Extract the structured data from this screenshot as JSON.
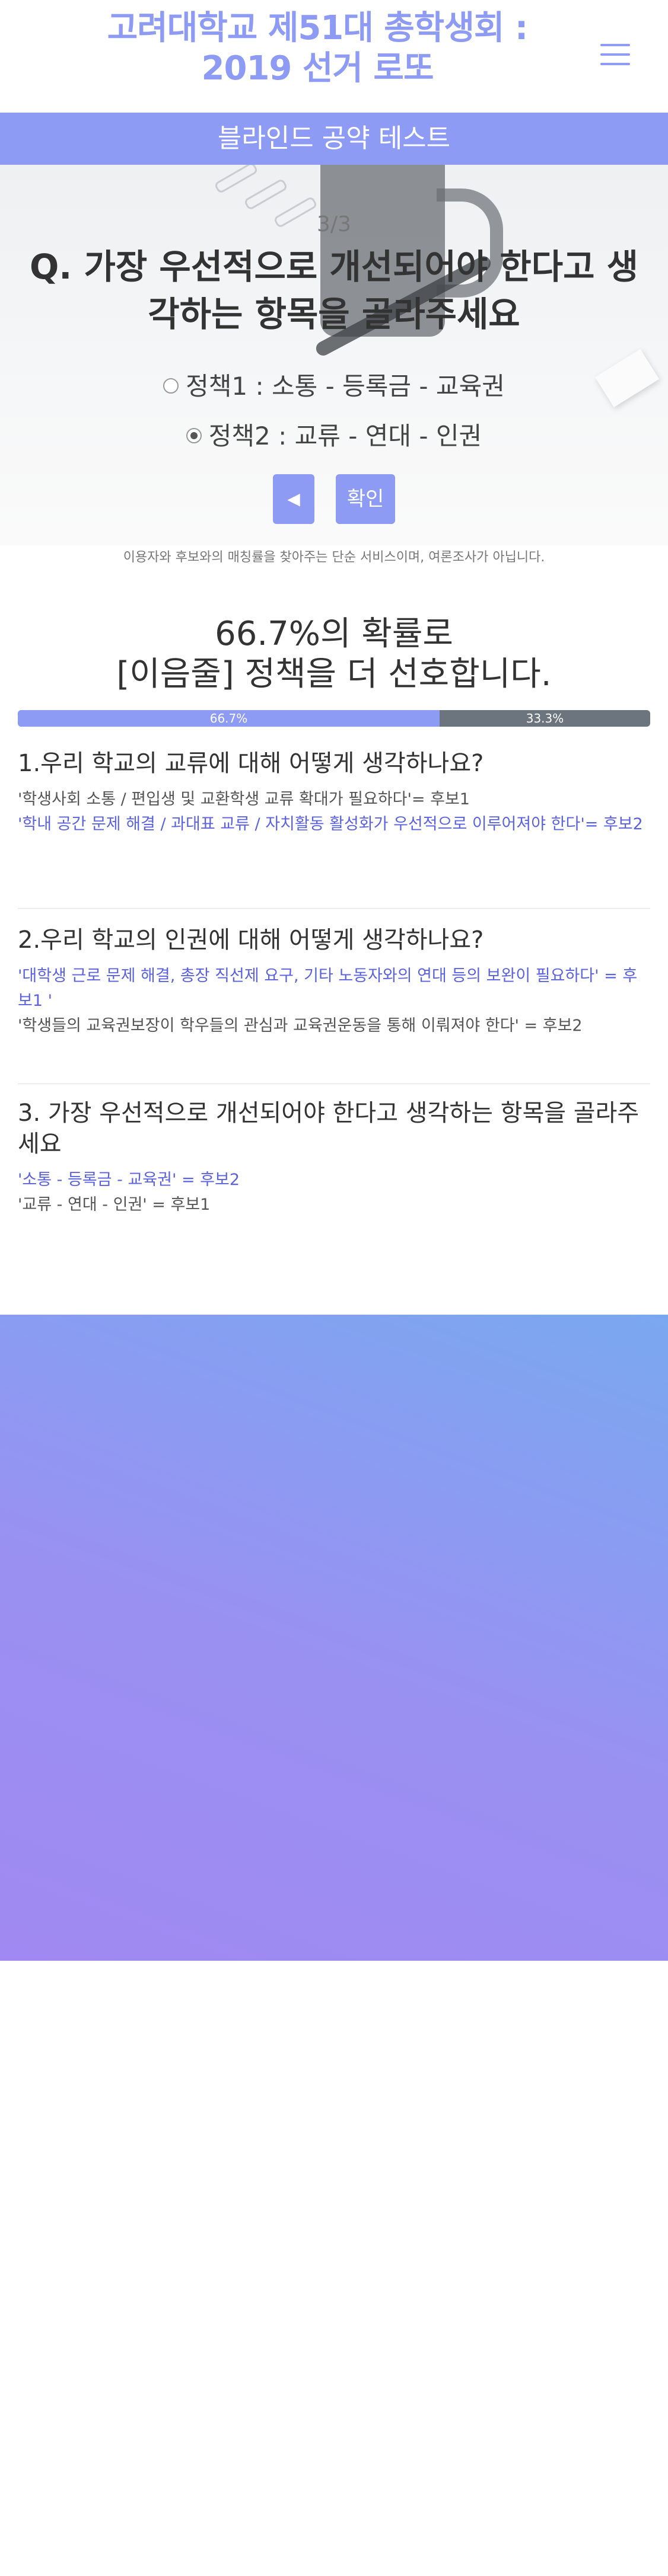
{
  "header": {
    "title_line1": "고려대학교 제51대 총학생회 :",
    "title_line2": "2019 선거 로또",
    "menu_icon": "hamburger-menu-icon"
  },
  "banner": {
    "label": "블라인드 공약 테스트"
  },
  "question": {
    "counter": "3/3",
    "text_line1": "Q. 가장 우선적으로 개선되어야 한다고 생",
    "text_line2": "각하는 항목을 골라주세요",
    "options": [
      {
        "label": "정책1 : 소통 - 등록금 - 교육권",
        "checked": false
      },
      {
        "label": "정책2 : 교류 - 연대 - 인권",
        "checked": true
      }
    ],
    "back_label": "◀",
    "confirm_label": "확인"
  },
  "disclaimer": "이용자와 후보와의 매칭률을 찾아주는 단순 서비스이며, 여론조사가 아닙니다.",
  "result": {
    "line1": "66.7%의 확률로",
    "line2": "[이음줄] 정책을 더 선호합니다.",
    "bar": {
      "first_label": "66.7%",
      "first_value": 66.7,
      "second_label": "33.3%",
      "second_value": 33.3
    },
    "colors": {
      "primary": "#8d9bf5",
      "secondary": "#6c757d"
    }
  },
  "sections": [
    {
      "title": "1.우리 학교의 교류에 대해 어떻게 생각하나요?",
      "answers": [
        {
          "text": "'학생사회 소통 / 편입생 및 교환학생 교류 확대가 필요하다'= 후보1",
          "highlight": false
        },
        {
          "text": "'학내 공간 문제 해결 / 과대표 교류 / 자치활동 활성화가 우선적으로 이루어져야 한다'= 후보2",
          "highlight": true
        }
      ]
    },
    {
      "title": "2.우리 학교의 인권에 대해 어떻게 생각하나요?",
      "answers": [
        {
          "text": "'대학생 근로 문제 해결, 총장 직선제 요구, 기타 노동자와의 연대 등의 보완이 필요하다' = 후보1 '",
          "highlight": true
        },
        {
          "text": "'학생들의 교육권보장이 학우들의 관심과 교육권운동을 통해 이뤄져야 한다' = 후보2",
          "highlight": false
        }
      ]
    },
    {
      "title": "3. 가장 우선적으로 개선되어야 한다고 생각하는 항목을 골라주세요",
      "answers": [
        {
          "text": "'소통 - 등록금 - 교육권' = 후보2",
          "highlight": true
        },
        {
          "text": "'교류 - 연대 - 인권' = 후보1",
          "highlight": false
        }
      ]
    }
  ]
}
